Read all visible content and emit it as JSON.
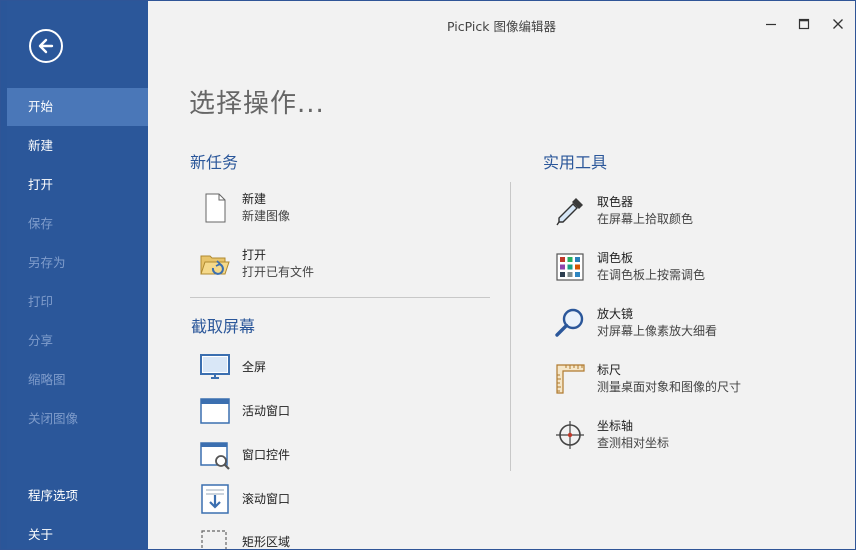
{
  "window": {
    "title": "PicPick 图像编辑器"
  },
  "sidebar": {
    "items": [
      {
        "label": "开始",
        "state": "active"
      },
      {
        "label": "新建",
        "state": "normal"
      },
      {
        "label": "打开",
        "state": "normal"
      },
      {
        "label": "保存",
        "state": "disabled"
      },
      {
        "label": "另存为",
        "state": "disabled"
      },
      {
        "label": "打印",
        "state": "disabled"
      },
      {
        "label": "分享",
        "state": "disabled"
      },
      {
        "label": "缩略图",
        "state": "disabled"
      },
      {
        "label": "关闭图像",
        "state": "disabled"
      }
    ],
    "bottom_items": [
      {
        "label": "程序选项"
      },
      {
        "label": "关于"
      }
    ]
  },
  "main": {
    "title": "选择操作...",
    "new_task": {
      "heading": "新任务",
      "items": [
        {
          "title": "新建",
          "desc": "新建图像",
          "icon": "blank-page-icon"
        },
        {
          "title": "打开",
          "desc": "打开已有文件",
          "icon": "open-folder-icon"
        }
      ]
    },
    "capture": {
      "heading": "截取屏幕",
      "items": [
        {
          "title": "全屏",
          "icon": "monitor-icon"
        },
        {
          "title": "活动窗口",
          "icon": "window-icon"
        },
        {
          "title": "窗口控件",
          "icon": "window-control-icon"
        },
        {
          "title": "滚动窗口",
          "icon": "scroll-window-icon"
        },
        {
          "title": "矩形区域",
          "icon": "rectangle-region-icon"
        }
      ]
    },
    "tools": {
      "heading": "实用工具",
      "items": [
        {
          "title": "取色器",
          "desc": "在屏幕上拾取颜色",
          "icon": "eyedropper-icon"
        },
        {
          "title": "调色板",
          "desc": "在调色板上按需调色",
          "icon": "palette-icon"
        },
        {
          "title": "放大镜",
          "desc": "对屏幕上像素放大细看",
          "icon": "magnifier-icon"
        },
        {
          "title": "标尺",
          "desc": "测量桌面对象和图像的尺寸",
          "icon": "ruler-icon"
        },
        {
          "title": "坐标轴",
          "desc": "查测相对坐标",
          "icon": "crosshair-icon"
        }
      ]
    }
  },
  "colors": {
    "sidebar_bg": "#2b579a",
    "sidebar_active": "#4a77b8",
    "accent": "#2b579a",
    "content_bg": "#f2f2f2"
  }
}
